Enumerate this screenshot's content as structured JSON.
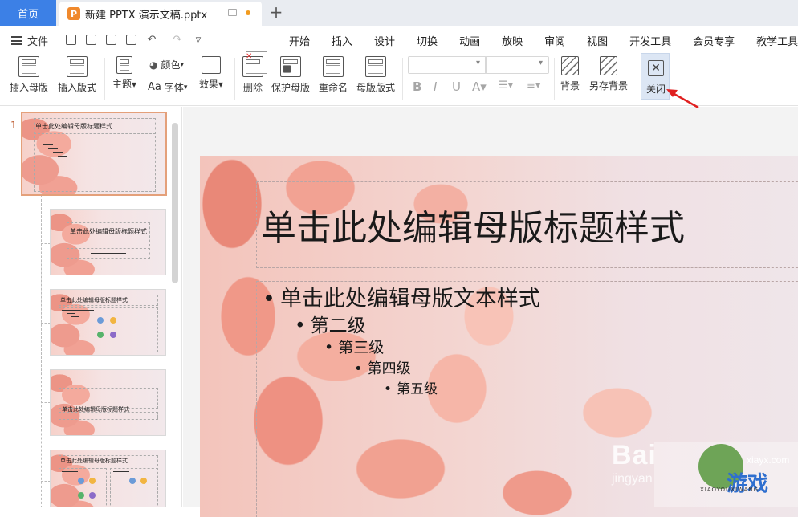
{
  "titlebar": {
    "home_tab": "首页",
    "doc_tab": "新建 PPTX 演示文稿.pptx",
    "new_tab": "+"
  },
  "menubar": {
    "file": "文件",
    "tabs": [
      "开始",
      "插入",
      "设计",
      "切换",
      "动画",
      "放映",
      "审阅",
      "视图",
      "开发工具",
      "会员专享",
      "教学工具"
    ]
  },
  "ribbon": {
    "insert_master": "插入母版",
    "insert_layout": "插入版式",
    "theme": "主题",
    "color": "颜色",
    "font": "字体",
    "effect": "效果",
    "delete": "删除",
    "protect_master": "保护母版",
    "rename": "重命名",
    "master_layout": "母版版式",
    "background": "背景",
    "save_background": "另存背景",
    "close": "关闭"
  },
  "thumbnails": {
    "slide_number": "1",
    "t1": "单击此处编辑母版标题样式",
    "t2": "单击此处编辑母版标题样式",
    "t3": "单击此处编辑母版标题样式",
    "t4": "单击此处编辑母版标题样式",
    "t5": "单击此处编辑母版标题样式"
  },
  "slide": {
    "title": "单击此处编辑母版标题样式",
    "level1": "单击此处编辑母版文本样式",
    "level2": "第二级",
    "level3": "第三级",
    "level4": "第四级",
    "level5": "第五级"
  },
  "watermark": {
    "baidu": "Bai",
    "jingyan": "jingyan",
    "site": "xiayx.com",
    "brand": "游戏",
    "pinyin": "XIAOYOUXIWANG"
  },
  "colors": {
    "home_tab": "#3c80e6",
    "pptx_logo": "#f0892d",
    "close_highlight": "#dce6f4",
    "annotation_arrow": "#e02020"
  }
}
